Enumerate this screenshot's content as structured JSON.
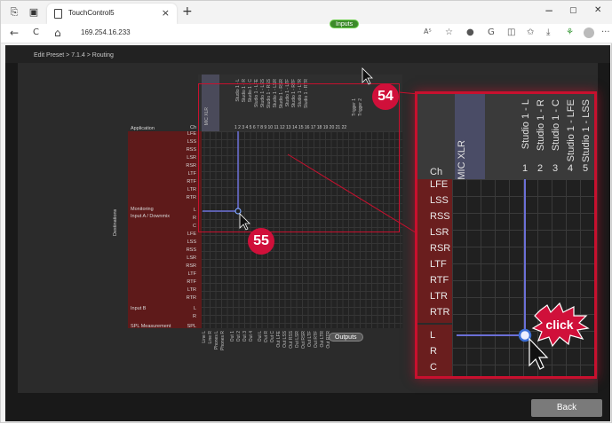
{
  "browser": {
    "tab_title": "TouchControl5",
    "url": "169.254.16.233",
    "icons": [
      "tab-actions-icon",
      "page-icon",
      "close-icon",
      "new-tab-icon",
      "minimize-icon",
      "restore-icon",
      "window-close-icon",
      "back-icon",
      "refresh-icon",
      "home-icon",
      "read-aloud-icon",
      "favorite-icon",
      "extension-icon",
      "collections-icon",
      "downloads-icon",
      "profile-icon",
      "more-icon"
    ],
    "glyphs": {
      "close": "×",
      "new_tab": "+",
      "minimize": "−",
      "restore": "▢",
      "window_close": "✕",
      "back": "←",
      "refresh": "C",
      "home": "⌂",
      "read_aloud": "A⁵",
      "favorite": "☆",
      "split": "◫",
      "star_list": "✩",
      "download": "⤓",
      "more": "···"
    }
  },
  "app": {
    "breadcrumb": "Edit Preset > 7.1.4 > Routing",
    "inputs_label": "Inputs",
    "outputs_label": "Outputs",
    "back_label": "Back",
    "destinations_label": "Destinations",
    "col_headers": [
      "MIC XLR",
      "Studio 1 - L",
      "Studio 1 - R",
      "Studio 1 - C",
      "Studio 1 - LFE",
      "Studio 1 - LSS",
      "Studio 1 - RSS",
      "Studio 1 - LSR",
      "Studio 1 - RSR",
      "Studio 1 - LTF",
      "Studio 1 - RTF",
      "Studio 1 - LTR",
      "Studio 1 - RTR",
      "Trigger 1",
      "Trigger 2"
    ],
    "col_numbers": "1 2 3 4 5 6 7 8 9 10 11 12 13 14 15 16 17 18 19 20 21 22",
    "groups": [
      {
        "name": "Application",
        "channels": [
          "Ch",
          "LFE",
          "LSS",
          "RSS",
          "LSR",
          "RSR",
          "LTF",
          "RTF",
          "LTR",
          "RTR"
        ]
      },
      {
        "name": "Monitoring",
        "sub": "Input A / Downmix",
        "channels": [
          "L",
          "R",
          "C",
          "LFE",
          "LSS",
          "RSS",
          "LSR",
          "RSR",
          "LTF",
          "RTF",
          "LTR",
          "RTR"
        ]
      },
      {
        "name": "Input B",
        "channels": [
          "L",
          "R"
        ]
      },
      {
        "name": "SPL Measurement",
        "channels": [
          "SPL"
        ]
      }
    ],
    "output_labels": [
      "Line L",
      "Line R",
      "Phones L",
      "Phones R",
      "Out 1",
      "Out 2",
      "Out 3",
      "Out 4",
      "Out L",
      "Out R",
      "Out C",
      "Out LFE",
      "Out LSS",
      "Out RSS",
      "Out LSR",
      "Out RSR",
      "Out LTF",
      "Out RTF",
      "Out LTR",
      "Out RTR"
    ]
  },
  "callouts": {
    "badge_1": "54",
    "badge_2": "55",
    "click": "click"
  },
  "zoom": {
    "ch_label": "Ch",
    "mic_label": "MIC XLR",
    "studio_cols": [
      "Studio 1 - L",
      "Studio 1 - R",
      "Studio 1 - C",
      "Studio 1 - LFE",
      "Studio 1 - LSS"
    ],
    "numbers": [
      "1",
      "2",
      "3",
      "4",
      "5"
    ],
    "rows_app": [
      "LFE",
      "LSS",
      "RSS",
      "LSR",
      "RSR",
      "LTF",
      "RTF",
      "LTR",
      "RTR"
    ],
    "rows_mon": [
      "L",
      "R",
      "C"
    ]
  },
  "colors": {
    "accent_red": "#c8102e",
    "route_line": "#6b6fd6",
    "inputs_green": "#3d8a2a",
    "destination_band": "#5e1a1a"
  }
}
